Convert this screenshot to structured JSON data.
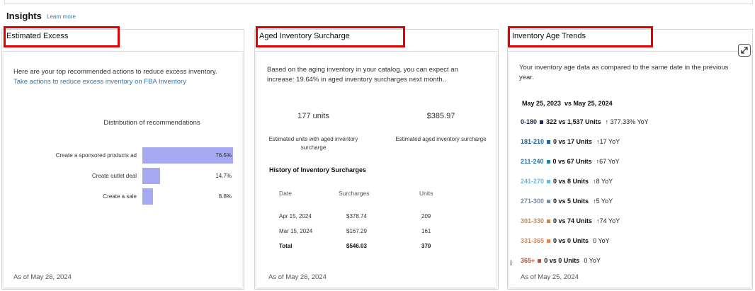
{
  "header": {
    "title": "Insights",
    "learn_more": "Learn more"
  },
  "cards": {
    "excess": {
      "title": "Estimated Excess",
      "description": "Here are your top recommended actions to reduce excess inventory.",
      "link": "Take actions to reduce excess inventory on FBA Inventory",
      "chart_title": "Distribution of recommendations",
      "as_of": "As of May 26, 2024"
    },
    "surcharge": {
      "title": "Aged Inventory Surcharge",
      "description": "Based on the aging inventory in your catalog, you can expect an increase: 19.64% in aged inventory surcharges next month..",
      "units_value": "177 units",
      "units_label": "Estimated units with aged inventory surcharge",
      "amount_value": "$385.97",
      "amount_label": "Estimated aged inventory surcharge",
      "history_title": "History of Inventory Surcharges",
      "columns": [
        "Date",
        "Surcharges",
        "Units"
      ],
      "rows": [
        {
          "date": "Apr 15, 2024",
          "surcharge": "$378.74",
          "units": "209"
        },
        {
          "date": "Mar 15, 2024",
          "surcharge": "$167.29",
          "units": "161"
        }
      ],
      "total": {
        "date": "Total",
        "surcharge": "$546.03",
        "units": "370"
      },
      "as_of": "As of May 26, 2024"
    },
    "trends": {
      "title": "Inventory Age Trends",
      "description": "Your inventory age data as compared to the same date in the previous year.",
      "compare_dates": "May 25, 2023  vs May 25, 2024",
      "rows": [
        {
          "range": "0-180",
          "color": "#1b2b4b",
          "units": "322 vs 1,537 Units",
          "yoy": "↑ 377.33% YoY"
        },
        {
          "range": "181-210",
          "color": "#1f5f9e",
          "units": "0 vs 17 Units",
          "yoy": "↑17 YoY"
        },
        {
          "range": "211-240",
          "color": "#2a7ab0",
          "units": "0 vs 67 Units",
          "yoy": "↑67 YoY"
        },
        {
          "range": "241-270",
          "color": "#6cb6e0",
          "units": "0 vs 8 Units",
          "yoy": "↑8 YoY"
        },
        {
          "range": "271-300",
          "color": "#7d8fa6",
          "units": "0 vs 5 Units",
          "yoy": "↑5 YoY"
        },
        {
          "range": "301-330",
          "color": "#c08a63",
          "units": "0 vs 74 Units",
          "yoy": "↑74 YoY"
        },
        {
          "range": "331-365",
          "color": "#d98a57",
          "units": "0 vs 0 Units",
          "yoy": "0 YoY"
        },
        {
          "range": "365+",
          "color": "#b0523a",
          "units": "0 vs 0 Units",
          "yoy": "0 YoY"
        }
      ],
      "as_of": "As of May 25, 2024"
    }
  },
  "chart_data": {
    "type": "bar",
    "title": "Distribution of recommendations",
    "orientation": "horizontal",
    "categories": [
      "Create a sponsored products ad",
      "Create outlet deal",
      "Create a sale"
    ],
    "values": [
      76.5,
      14.7,
      8.8
    ],
    "value_labels": [
      "76.5%",
      "14.7%",
      "8.8%"
    ],
    "xlim": [
      0,
      76.5
    ],
    "bar_color": "#a7a8f2"
  }
}
